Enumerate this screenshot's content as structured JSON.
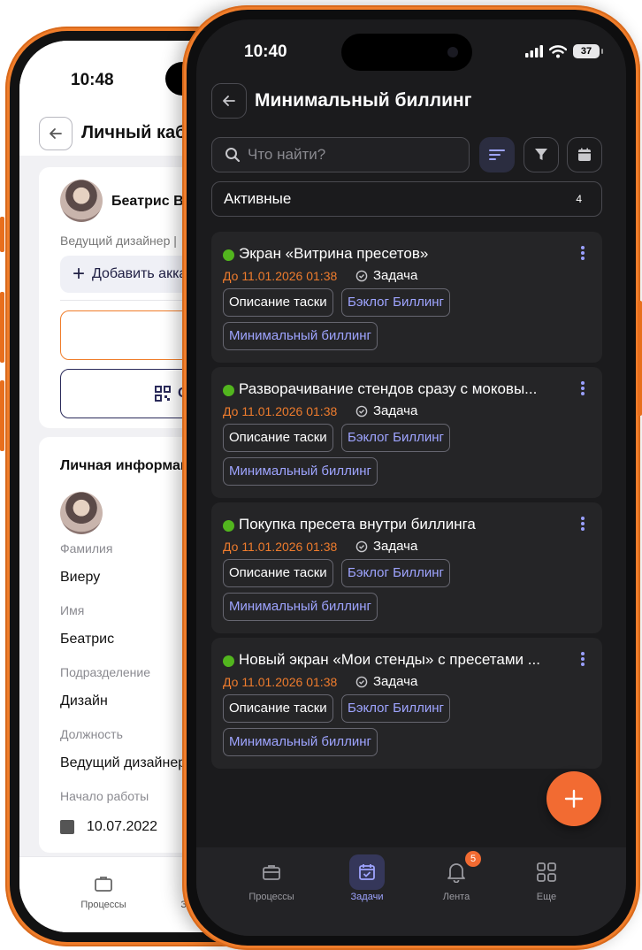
{
  "back_phone": {
    "time": "10:48",
    "title": "Личный каби",
    "user": {
      "name": "Беатрис Вие",
      "role": "Ведущий дизайнер |"
    },
    "add_account_label": "Добавить акка",
    "qr_button_label": "Ск",
    "personal_info_title": "Личная информация",
    "fields": [
      {
        "label": "Фамилия",
        "value": "Виеру"
      },
      {
        "label": "Имя",
        "value": "Беатрис"
      },
      {
        "label": "Подразделение",
        "value": "Дизайн"
      },
      {
        "label": "Должность",
        "value": "Ведущий дизайнер"
      },
      {
        "label": "Начало работы",
        "value": "10.07.2022"
      }
    ],
    "nav": [
      {
        "label": "Процессы",
        "icon": "briefcase-icon"
      },
      {
        "label": "Зада",
        "icon": "calendar-check-icon"
      }
    ]
  },
  "front_phone": {
    "time": "10:40",
    "battery": "37",
    "title": "Минимальный биллинг",
    "search": {
      "placeholder": "Что найти?",
      "value": ""
    },
    "status_filter": {
      "value": "Активные",
      "count": "4"
    },
    "tasks": [
      {
        "title": "Экран «Витрина пресетов»",
        "due": "До 11.01.2026 01:38",
        "kind": "Задача",
        "status_color": "#52b51e",
        "tags": [
          "Описание таски",
          "Бэклог Биллинг",
          "Минимальный биллинг"
        ]
      },
      {
        "title": "Разворачивание стендов сразу с моковы...",
        "due": "До 11.01.2026 01:38",
        "kind": "Задача",
        "status_color": "#52b51e",
        "tags": [
          "Описание таски",
          "Бэклог Биллинг",
          "Минимальный биллинг"
        ]
      },
      {
        "title": "Покупка пресета внутри биллинга",
        "due": "До 11.01.2026 01:38",
        "kind": "Задача",
        "status_color": "#52b51e",
        "tags": [
          "Описание таски",
          "Бэклог Биллинг",
          "Минимальный биллинг"
        ]
      },
      {
        "title": "Новый экран «Мои стенды» с пресетами ...",
        "due": "До 11.01.2026 01:38",
        "kind": "Задача",
        "status_color": "#52b51e",
        "tags": [
          "Описание таски",
          "Бэклог Биллинг",
          "Минимальный биллинг"
        ]
      }
    ],
    "tabs": [
      {
        "label": "Процессы",
        "icon": "briefcase-icon"
      },
      {
        "label": "Задачи",
        "icon": "calendar-check-icon",
        "active": true
      },
      {
        "label": "Лента",
        "icon": "bell-icon",
        "badge": "5"
      },
      {
        "label": "Еще",
        "icon": "grid-icon"
      }
    ]
  },
  "colors": {
    "accent": "#f07d2a",
    "fab": "#f26b32",
    "link": "#9ea4ff",
    "status_green": "#52b51e",
    "dark_bg": "#1b1b1d",
    "card_bg": "#252527"
  }
}
